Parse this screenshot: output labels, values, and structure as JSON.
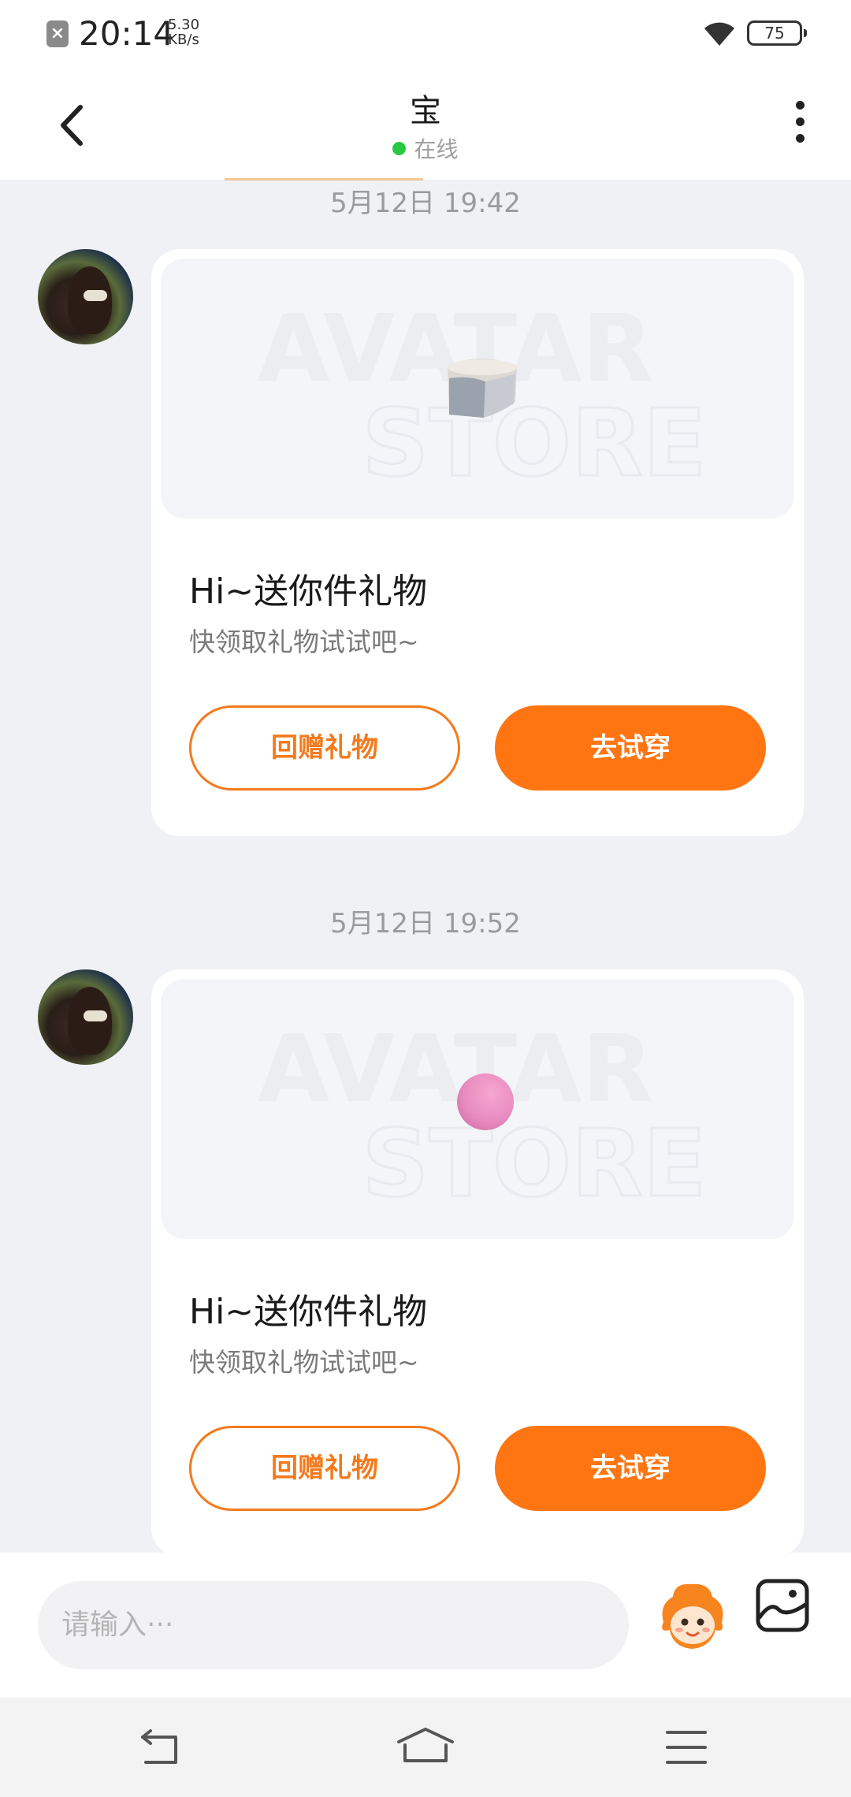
{
  "status_bar": {
    "time": "20:14",
    "speed_value": "5.30",
    "speed_unit": "KB/s",
    "battery": "75"
  },
  "header": {
    "title": "宝",
    "status_text": "在线",
    "back_icon": "chevron-left-icon",
    "more_icon": "more-vertical-icon"
  },
  "messages": [
    {
      "timestamp": "5月12日 19:42",
      "card_title": "Hi~送你件礼物",
      "card_subtitle": "快领取礼物试试吧~",
      "return_gift_label": "回赠礼物",
      "try_on_label": "去试穿",
      "watermark_line1": "AVATAR",
      "watermark_line2": "STORE"
    },
    {
      "timestamp": "5月12日 19:52",
      "card_title": "Hi~送你件礼物",
      "card_subtitle": "快领取礼物试试吧~",
      "return_gift_label": "回赠礼物",
      "try_on_label": "去试穿",
      "watermark_line1": "AVATAR",
      "watermark_line2": "STORE"
    }
  ],
  "input": {
    "placeholder": "请输入···"
  },
  "colors": {
    "accent": "#ff7511",
    "online": "#28c840",
    "chat_background": "#eff1f5"
  }
}
